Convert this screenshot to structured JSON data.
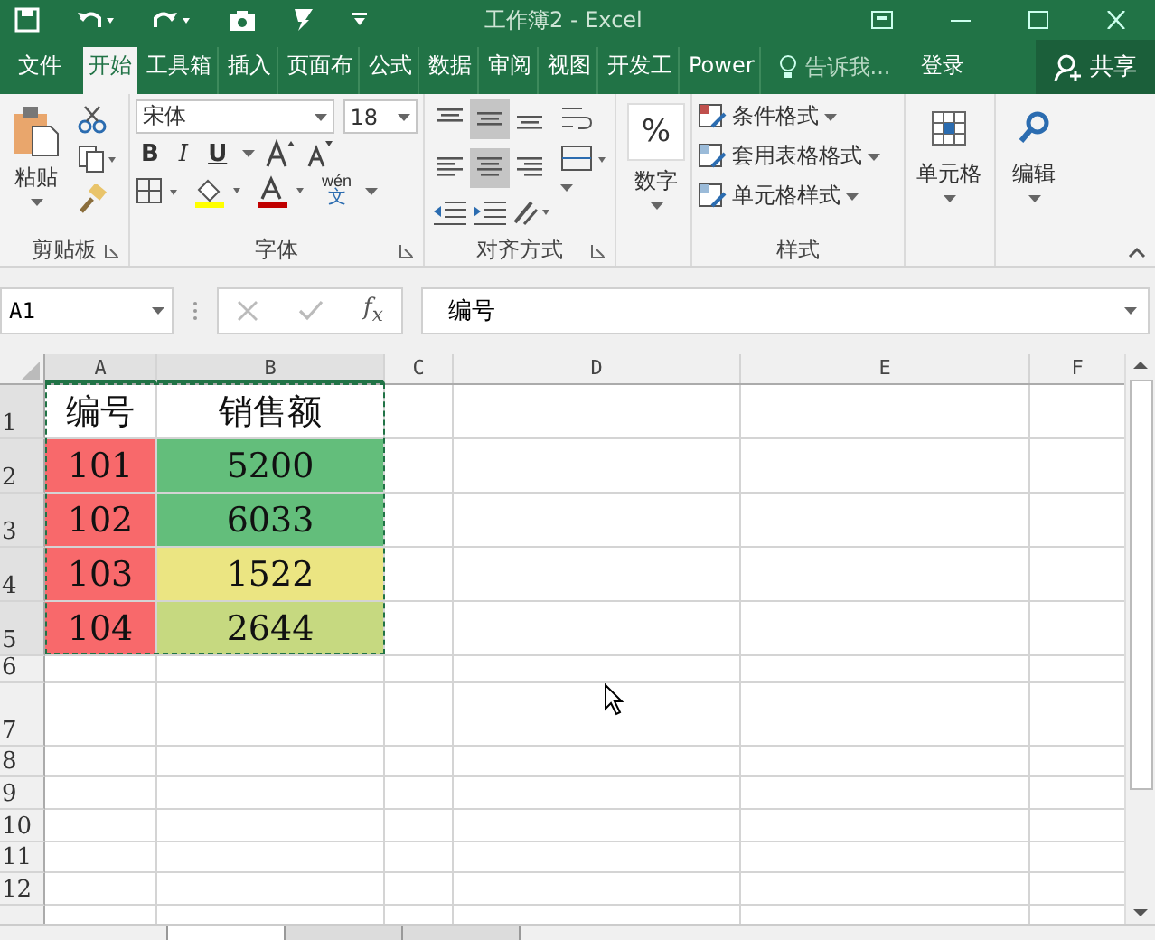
{
  "window": {
    "title": "工作簿2 - Excel"
  },
  "tabs": [
    {
      "label": "文件",
      "selected": false
    },
    {
      "label": "开始",
      "selected": true
    },
    {
      "label": "工具箱",
      "selected": false
    },
    {
      "label": "插入",
      "selected": false
    },
    {
      "label": "页面布",
      "selected": false
    },
    {
      "label": "公式",
      "selected": false
    },
    {
      "label": "数据",
      "selected": false
    },
    {
      "label": "审阅",
      "selected": false
    },
    {
      "label": "视图",
      "selected": false
    },
    {
      "label": "开发工",
      "selected": false
    },
    {
      "label": "Power",
      "selected": false
    }
  ],
  "tell_me": {
    "placeholder": "告诉我..."
  },
  "sign_in": "登录",
  "share": "共享",
  "clipboard": {
    "paste": "粘贴",
    "label": "剪贴板"
  },
  "font": {
    "name": "宋体",
    "size": "18",
    "bold": "B",
    "italic": "I",
    "underline": "U",
    "phonetic": "wén",
    "phonetic_char": "文",
    "label": "字体"
  },
  "alignment": {
    "label": "对齐方式",
    "buttons": [
      {
        "selected": false
      },
      {
        "selected": true
      },
      {
        "selected": false
      },
      {
        "selected": false
      },
      {
        "selected": true
      },
      {
        "selected": false
      }
    ]
  },
  "number": {
    "symbol": "%",
    "label": "数字"
  },
  "styles": {
    "items": [
      "条件格式",
      "套用表格格式",
      "单元格样式"
    ],
    "label": "样式"
  },
  "cells_group": {
    "label": "单元格"
  },
  "editing": {
    "label": "编辑"
  },
  "formula_bar": {
    "name_box": "A1",
    "fx": "f$_{x}$",
    "value": "编号"
  },
  "sheet": {
    "columns": [
      "A",
      "B",
      "C",
      "D",
      "E",
      "F"
    ],
    "rows": [
      {
        "header": "1",
        "cells": [
          {
            "text": "编号"
          },
          {
            "text": "销售额"
          }
        ]
      },
      {
        "header": "2",
        "cells": [
          {
            "text": "101",
            "color": "#f8696b"
          },
          {
            "text": "5200",
            "color": "#63be7b"
          }
        ]
      },
      {
        "header": "3",
        "cells": [
          {
            "text": "102",
            "color": "#f8696b"
          },
          {
            "text": "6033",
            "color": "#63be7b"
          }
        ]
      },
      {
        "header": "4",
        "cells": [
          {
            "text": "103",
            "color": "#f8696b"
          },
          {
            "text": "1522",
            "color": "#ebe582"
          }
        ]
      },
      {
        "header": "5",
        "cells": [
          {
            "text": "104",
            "color": "#f8696b"
          },
          {
            "text": "2644",
            "color": "#c6d980"
          }
        ]
      },
      {
        "header": "6",
        "cells": []
      },
      {
        "header": "7",
        "cells": []
      },
      {
        "header": "8",
        "cells": []
      },
      {
        "header": "9",
        "cells": []
      },
      {
        "header": "10",
        "cells": []
      },
      {
        "header": "11",
        "cells": []
      },
      {
        "header": "12",
        "cells": []
      }
    ]
  },
  "sheet_tabs": [
    {
      "selected": true
    },
    {
      "selected": false
    },
    {
      "selected": false
    }
  ]
}
